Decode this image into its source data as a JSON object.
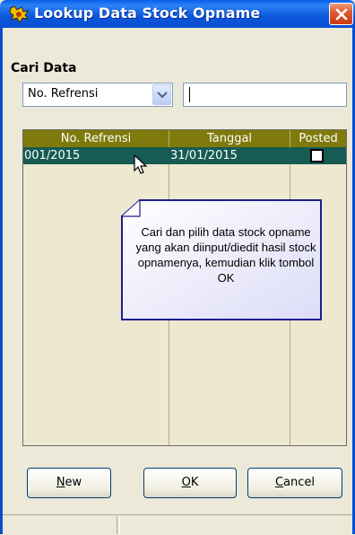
{
  "window": {
    "title": "Lookup Data Stock Opname",
    "titlebar_color": "#0a56dc",
    "close_color": "#e0552e"
  },
  "search": {
    "label": "Cari Data",
    "field_selected": "No. Refrensi",
    "query": ""
  },
  "grid": {
    "header_color": "#7f7a0b",
    "selected_row_color": "#165b54",
    "columns": [
      "No. Refrensi",
      "Tanggal",
      "Posted"
    ],
    "rows": [
      {
        "no_refrensi": "001/2015",
        "tanggal": "31/01/2015",
        "posted": false
      }
    ]
  },
  "tooltip": {
    "text": "Cari dan pilih data stock opname yang akan diinput/diedit hasil stock opnamenya, kemudian klik tombol OK"
  },
  "buttons": {
    "new_rest": "ew",
    "ok_rest": "K",
    "cancel_rest": "ancel"
  }
}
